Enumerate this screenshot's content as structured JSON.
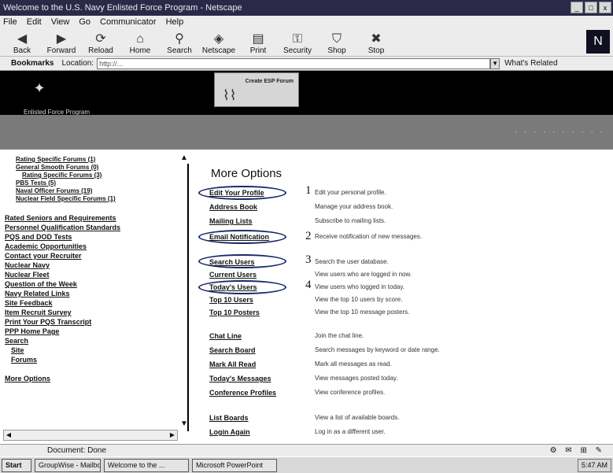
{
  "window": {
    "title": "Welcome to the U.S. Navy Enlisted Force Program - Netscape",
    "buttons": [
      "_",
      "□",
      "x"
    ]
  },
  "menu": [
    "File",
    "Edit",
    "View",
    "Go",
    "Communicator",
    "Help"
  ],
  "toolbar": [
    {
      "label": "Back",
      "icon": "back-arrow-icon"
    },
    {
      "label": "Forward",
      "icon": "forward-arrow-icon"
    },
    {
      "label": "Reload",
      "icon": "reload-icon"
    },
    {
      "label": "Home",
      "icon": "home-icon"
    },
    {
      "label": "Search",
      "icon": "search-icon"
    },
    {
      "label": "Netscape",
      "icon": "netscape-icon"
    },
    {
      "label": "Print",
      "icon": "print-icon"
    },
    {
      "label": "Security",
      "icon": "security-icon"
    },
    {
      "label": "Shop",
      "icon": "shop-icon"
    },
    {
      "label": "Stop",
      "icon": "stop-icon"
    }
  ],
  "location": {
    "bookmarks_label": "Bookmarks",
    "location_label": "Location:",
    "url": "http://...",
    "related_label": "What's Related"
  },
  "banner": {
    "site_name": "Enlisted Force Program",
    "ad_text": "Create ESP Forum"
  },
  "sidebar": {
    "items": [
      "Rating Specific Forums (1)",
      "General Smooth Forums (0)",
      "Rating Specific Forums (3)",
      "PBS Tests (5)",
      "Naval Officer Forums (19)",
      "Nuclear Field Specific Forums (1)",
      "Rated Seniors and Requirements",
      "Personnel Qualification Standards",
      "PQS and DOD Tests",
      "Academic Opportunities",
      "Contact your Recruiter",
      "Nuclear Navy",
      "Nuclear Fleet",
      "Question of the Week",
      "Navy Related Links",
      "Site Feedback",
      "Item Recruit Survey",
      "Print Your PQS Transcript",
      "PPP Home Page",
      "Search",
      "Site",
      "Forums",
      "More Options"
    ]
  },
  "main": {
    "heading": "More Options",
    "options": [
      {
        "link": "Edit Your Profile",
        "desc": "Edit your personal profile."
      },
      {
        "link": "Address Book",
        "desc": "Manage your address book."
      },
      {
        "link": "Mailing Lists",
        "desc": "Subscribe to mailing lists."
      },
      {
        "link": "Email Notification",
        "desc": "Receive notification of new messages."
      },
      {
        "link": "Search Users",
        "desc": "Search the user database."
      },
      {
        "link": "Current Users",
        "desc": "View users who are logged in now."
      },
      {
        "link": "Today's Users",
        "desc": "View users who logged in today."
      },
      {
        "link": "Top 10 Users",
        "desc": "View the top 10 users by score."
      },
      {
        "link": "Top 10 Posters",
        "desc": "View the top 10 message posters."
      },
      {
        "link": "Chat Line",
        "desc": "Join the chat line."
      },
      {
        "link": "Search Board",
        "desc": "Search messages by keyword or date range."
      },
      {
        "link": "Mark All Read",
        "desc": "Mark all messages as read."
      },
      {
        "link": "Today's Messages",
        "desc": "View messages posted today."
      },
      {
        "link": "Conference Profiles",
        "desc": "View conference profiles."
      },
      {
        "link": "List Boards",
        "desc": "View a list of available boards."
      },
      {
        "link": "Login Again",
        "desc": "Log in as a different user."
      }
    ],
    "annotations": [
      "1",
      "2",
      "3",
      "4"
    ]
  },
  "status": {
    "text": "Document: Done"
  },
  "taskbar": {
    "start": "Start",
    "buttons": [
      "GroupWise - Mailbox",
      "Welcome to the ...",
      "Microsoft PowerPoint"
    ],
    "tray": "5:47 AM"
  }
}
